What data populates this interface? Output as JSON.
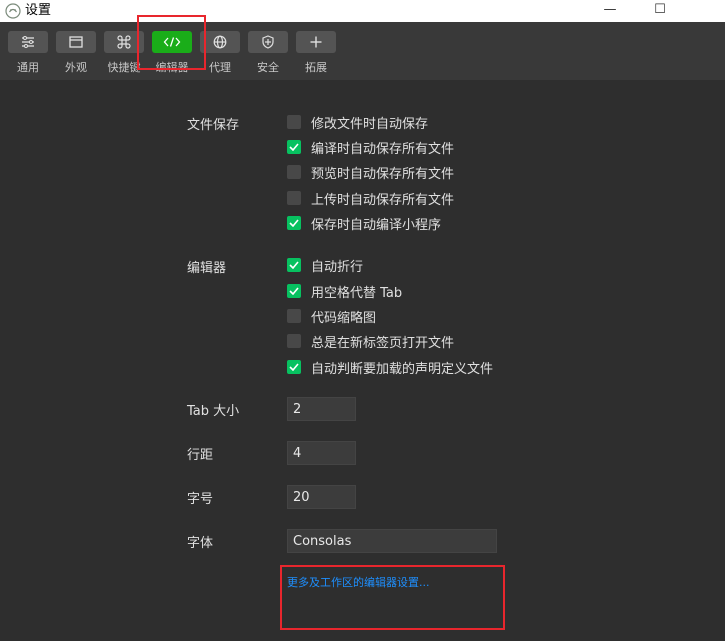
{
  "window": {
    "title": "设置",
    "minimize": "—",
    "maximize": "☐"
  },
  "toolbar": {
    "items": [
      {
        "label": "通用",
        "icon": "sliders-icon",
        "active": false
      },
      {
        "label": "外观",
        "icon": "layout-icon",
        "active": false
      },
      {
        "label": "快捷键",
        "icon": "command-key-icon",
        "active": false
      },
      {
        "label": "编辑器",
        "icon": "code-icon",
        "active": true
      },
      {
        "label": "代理",
        "icon": "globe-icon",
        "active": false
      },
      {
        "label": "安全",
        "icon": "shield-icon",
        "active": false
      },
      {
        "label": "拓展",
        "icon": "plus-icon",
        "active": false
      }
    ]
  },
  "file_save": {
    "label": "文件保存",
    "options": [
      {
        "label": "修改文件时自动保存",
        "checked": false
      },
      {
        "label": "编译时自动保存所有文件",
        "checked": true
      },
      {
        "label": "预览时自动保存所有文件",
        "checked": false
      },
      {
        "label": "上传时自动保存所有文件",
        "checked": false
      },
      {
        "label": "保存时自动编译小程序",
        "checked": true
      }
    ]
  },
  "editor": {
    "label": "编辑器",
    "options": [
      {
        "label": "自动折行",
        "checked": true
      },
      {
        "label": "用空格代替 Tab",
        "checked": true
      },
      {
        "label": "代码缩略图",
        "checked": false
      },
      {
        "label": "总是在新标签页打开文件",
        "checked": false
      },
      {
        "label": "自动判断要加载的声明定义文件",
        "checked": true
      }
    ]
  },
  "fields": {
    "tab_size": {
      "label": "Tab 大小",
      "value": "2"
    },
    "line_height": {
      "label": "行距",
      "value": "4"
    },
    "font_size": {
      "label": "字号",
      "value": "20"
    },
    "font_family": {
      "label": "字体",
      "value": "Consolas"
    }
  },
  "more_link": "更多及工作区的编辑器设置...",
  "colors": {
    "accent": "#07c160",
    "link": "#1e8ffe",
    "highlight": "#e8262d"
  }
}
